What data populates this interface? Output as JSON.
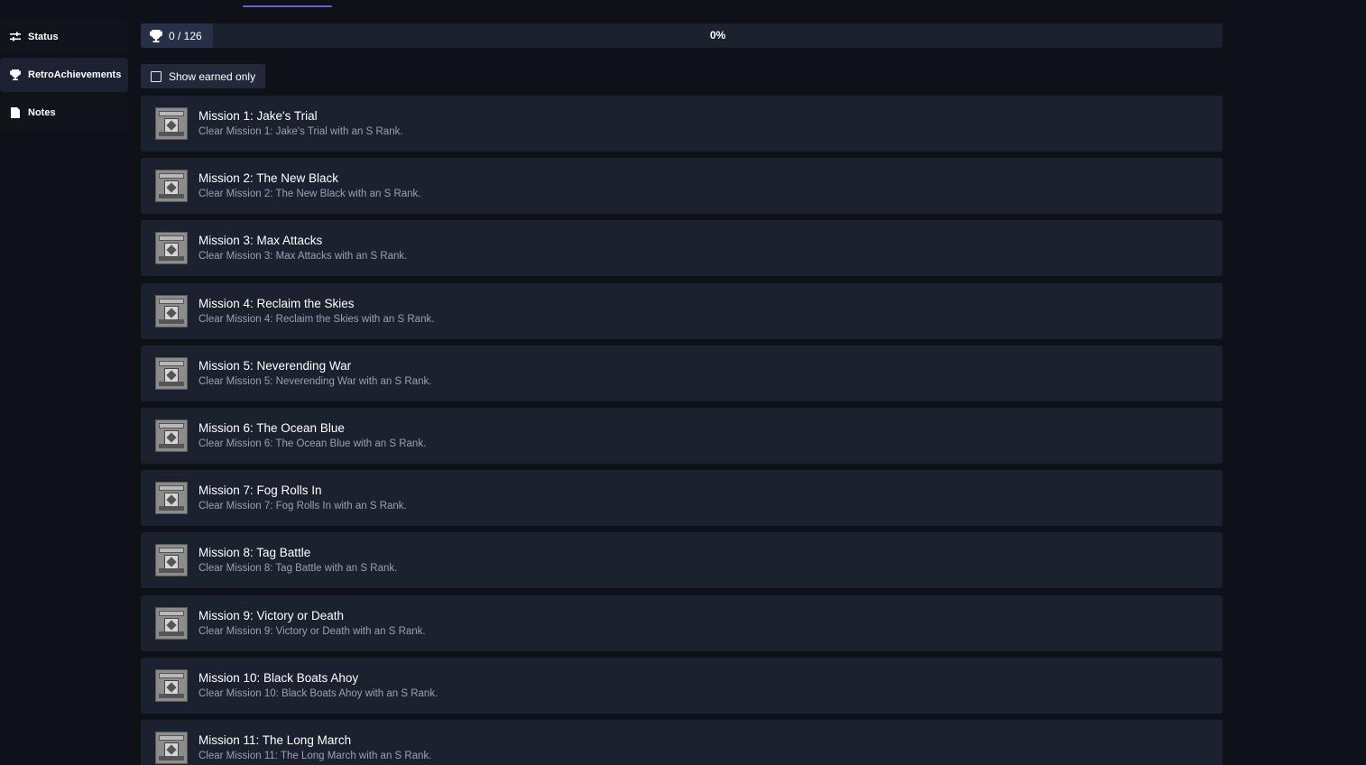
{
  "sidebar": {
    "items": [
      {
        "label": "Status",
        "icon": "sliders-icon"
      },
      {
        "label": "RetroAchievements",
        "icon": "trophy-icon"
      },
      {
        "label": "Notes",
        "icon": "notes-icon"
      }
    ],
    "active": "RetroAchievements"
  },
  "progress": {
    "count_text": "0 / 126",
    "earned": 0,
    "total": 126,
    "percent_text": "0%",
    "accent_color": "#6c5ccf"
  },
  "filter": {
    "show_earned_label": "Show earned only",
    "checked": false
  },
  "achievements": [
    {
      "title": "Mission 1: Jake's Trial",
      "description": "Clear Mission 1: Jake's Trial with an S Rank."
    },
    {
      "title": "Mission 2: The New Black",
      "description": "Clear Mission 2: The New Black with an S Rank."
    },
    {
      "title": "Mission 3: Max Attacks",
      "description": "Clear Mission 3: Max Attacks with an S Rank."
    },
    {
      "title": "Mission 4: Reclaim the Skies",
      "description": "Clear Mission 4: Reclaim the Skies with an S Rank."
    },
    {
      "title": "Mission 5: Neverending War",
      "description": "Clear Mission 5: Neverending War with an S Rank."
    },
    {
      "title": "Mission 6: The Ocean Blue",
      "description": "Clear Mission 6: The Ocean Blue with an S Rank."
    },
    {
      "title": "Mission 7: Fog Rolls In",
      "description": "Clear Mission 7: Fog Rolls In with an S Rank."
    },
    {
      "title": "Mission 8: Tag Battle",
      "description": "Clear Mission 8: Tag Battle with an S Rank."
    },
    {
      "title": "Mission 9: Victory or Death",
      "description": "Clear Mission 9: Victory or Death with an S Rank."
    },
    {
      "title": "Mission 10: Black Boats Ahoy",
      "description": "Clear Mission 10: Black Boats Ahoy with an S Rank."
    },
    {
      "title": "Mission 11: The Long March",
      "description": "Clear Mission 11: The Long March with an S Rank."
    }
  ]
}
